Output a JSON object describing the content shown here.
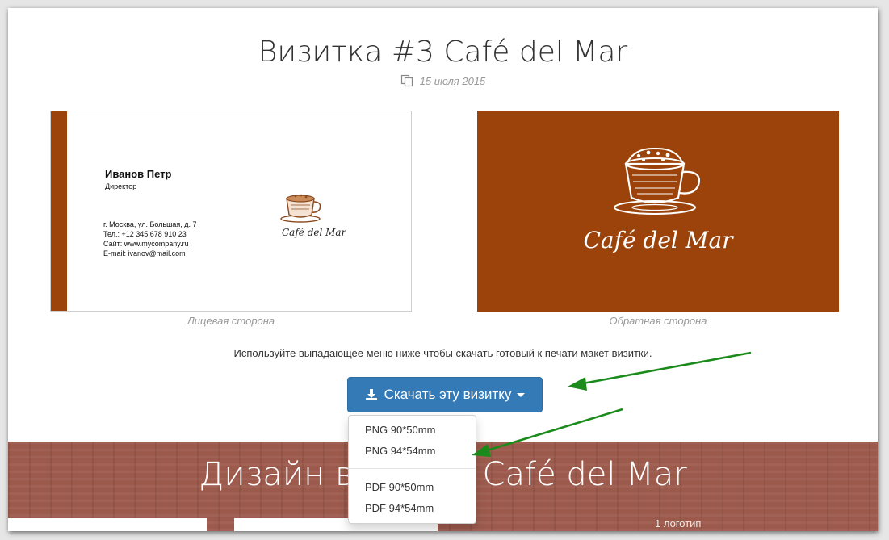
{
  "page": {
    "title": "Визитка #3 Café del Mar",
    "date": "15 июля 2015"
  },
  "front_card": {
    "name": "Иванов Петр",
    "role": "Директор",
    "address": "г. Москва, ул. Большая, д. 7",
    "phone": "Тел.: +12 345 678 910 23",
    "site": "Сайт: www.mycompany.ru",
    "email": "E-mail: ivanov@mail.com",
    "logo_text": "Café del Mar",
    "caption": "Лицевая сторона"
  },
  "back_card": {
    "logo_text": "Café del Mar",
    "caption": "Обратная сторона"
  },
  "instruction": "Используйте выпадающее меню ниже чтобы скачать готовый к печати макет визитки.",
  "download": {
    "label": "Скачать эту визитку",
    "options": [
      "PNG 90*50mm",
      "PNG 94*54mm",
      "PDF 90*50mm",
      "PDF 94*54mm"
    ]
  },
  "design_section": {
    "title": "Дизайн визитки Café del Mar",
    "note": "1 логотип"
  },
  "colors": {
    "brand_brown": "#9b430b",
    "button_blue": "#337ab7",
    "arrow_green": "#1a8a1a",
    "band_brown": "#9c5a4c"
  },
  "icons": [
    "copy-icon",
    "download-icon",
    "caret-down-icon",
    "coffee-cup-icon"
  ]
}
